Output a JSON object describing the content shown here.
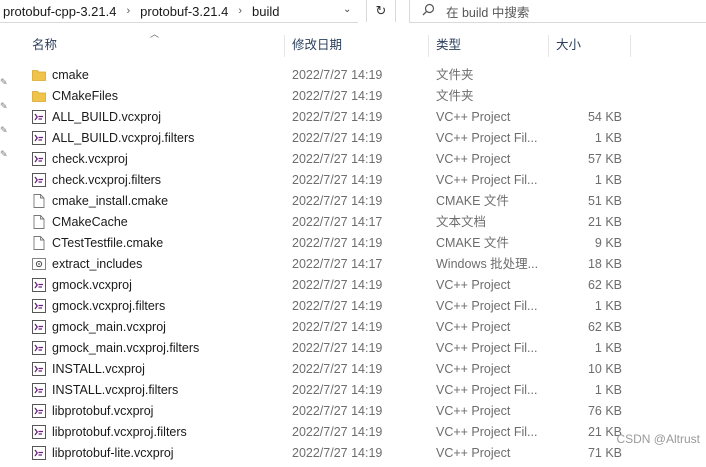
{
  "breadcrumb": [
    "protobuf-cpp-3.21.4",
    "protobuf-3.21.4",
    "build"
  ],
  "breadcrumb_separator": "›",
  "search": {
    "placeholder": "在 build 中搜索"
  },
  "columns": {
    "name": "名称",
    "date": "修改日期",
    "type": "类型",
    "size": "大小"
  },
  "files": [
    {
      "name": "cmake",
      "date": "2022/7/27 14:19",
      "type": "文件夹",
      "size": "",
      "icon": "folder"
    },
    {
      "name": "CMakeFiles",
      "date": "2022/7/27 14:19",
      "type": "文件夹",
      "size": "",
      "icon": "folder"
    },
    {
      "name": "ALL_BUILD.vcxproj",
      "date": "2022/7/27 14:19",
      "type": "VC++ Project",
      "size": "54 KB",
      "icon": "vcxproj"
    },
    {
      "name": "ALL_BUILD.vcxproj.filters",
      "date": "2022/7/27 14:19",
      "type": "VC++ Project Fil...",
      "size": "1 KB",
      "icon": "vcxproj"
    },
    {
      "name": "check.vcxproj",
      "date": "2022/7/27 14:19",
      "type": "VC++ Project",
      "size": "57 KB",
      "icon": "vcxproj"
    },
    {
      "name": "check.vcxproj.filters",
      "date": "2022/7/27 14:19",
      "type": "VC++ Project Fil...",
      "size": "1 KB",
      "icon": "vcxproj"
    },
    {
      "name": "cmake_install.cmake",
      "date": "2022/7/27 14:19",
      "type": "CMAKE 文件",
      "size": "51 KB",
      "icon": "file"
    },
    {
      "name": "CMakeCache",
      "date": "2022/7/27 14:17",
      "type": "文本文档",
      "size": "21 KB",
      "icon": "file"
    },
    {
      "name": "CTestTestfile.cmake",
      "date": "2022/7/27 14:19",
      "type": "CMAKE 文件",
      "size": "9 KB",
      "icon": "file"
    },
    {
      "name": "extract_includes",
      "date": "2022/7/27 14:17",
      "type": "Windows 批处理...",
      "size": "18 KB",
      "icon": "bat"
    },
    {
      "name": "gmock.vcxproj",
      "date": "2022/7/27 14:19",
      "type": "VC++ Project",
      "size": "62 KB",
      "icon": "vcxproj"
    },
    {
      "name": "gmock.vcxproj.filters",
      "date": "2022/7/27 14:19",
      "type": "VC++ Project Fil...",
      "size": "1 KB",
      "icon": "vcxproj"
    },
    {
      "name": "gmock_main.vcxproj",
      "date": "2022/7/27 14:19",
      "type": "VC++ Project",
      "size": "62 KB",
      "icon": "vcxproj"
    },
    {
      "name": "gmock_main.vcxproj.filters",
      "date": "2022/7/27 14:19",
      "type": "VC++ Project Fil...",
      "size": "1 KB",
      "icon": "vcxproj"
    },
    {
      "name": "INSTALL.vcxproj",
      "date": "2022/7/27 14:19",
      "type": "VC++ Project",
      "size": "10 KB",
      "icon": "vcxproj"
    },
    {
      "name": "INSTALL.vcxproj.filters",
      "date": "2022/7/27 14:19",
      "type": "VC++ Project Fil...",
      "size": "1 KB",
      "icon": "vcxproj"
    },
    {
      "name": "libprotobuf.vcxproj",
      "date": "2022/7/27 14:19",
      "type": "VC++ Project",
      "size": "76 KB",
      "icon": "vcxproj"
    },
    {
      "name": "libprotobuf.vcxproj.filters",
      "date": "2022/7/27 14:19",
      "type": "VC++ Project Fil...",
      "size": "21 KB",
      "icon": "vcxproj"
    },
    {
      "name": "libprotobuf-lite.vcxproj",
      "date": "2022/7/27 14:19",
      "type": "VC++ Project",
      "size": "71 KB",
      "icon": "vcxproj"
    }
  ],
  "watermark": "CSDN @Altrust",
  "colors": {
    "folder": "#f0c34a",
    "folder_dark": "#d9a62b",
    "vcxproj": "#68217a",
    "header_text": "#2b3f5c"
  }
}
